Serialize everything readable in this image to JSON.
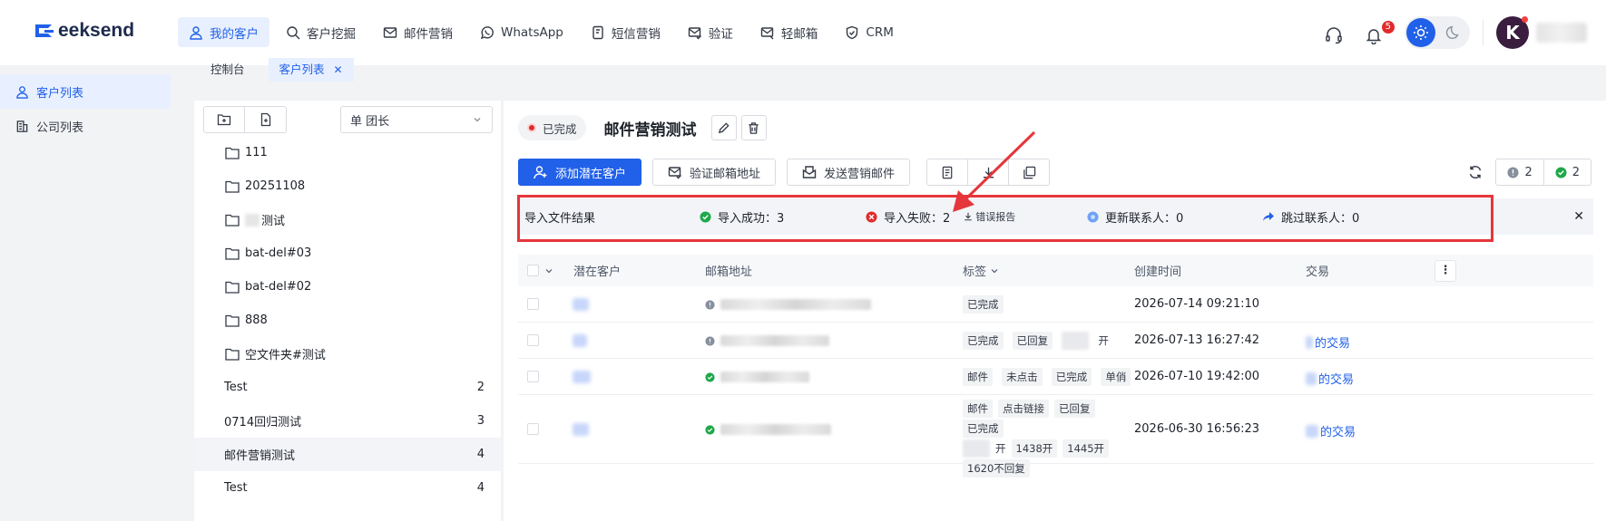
{
  "app": {
    "logo_text": "eeksend",
    "logo_letter": "G",
    "brand_color": "#2160e8",
    "alert_color": "#e5363b"
  },
  "nav": {
    "items": [
      {
        "label": "我的客户",
        "icon": "user-icon",
        "active": true
      },
      {
        "label": "客户挖掘",
        "icon": "search-icon"
      },
      {
        "label": "邮件营销",
        "icon": "mail-icon"
      },
      {
        "label": "WhatsApp",
        "icon": "whatsapp-icon"
      },
      {
        "label": "短信营销",
        "icon": "sms-icon"
      },
      {
        "label": "验证",
        "icon": "mail-check-icon"
      },
      {
        "label": "轻邮箱",
        "icon": "light-mail-icon"
      },
      {
        "label": "CRM",
        "icon": "shield-icon"
      }
    ]
  },
  "header": {
    "notification_count": "5",
    "avatar_letter": "K"
  },
  "page_tabs": {
    "tab1": "控制台",
    "tab2": "客户列表"
  },
  "sidebar": {
    "items": [
      {
        "label": "客户列表",
        "icon": "user-icon",
        "active": true
      },
      {
        "label": "公司列表",
        "icon": "building-icon"
      }
    ]
  },
  "tree": {
    "select_value": "单 团长",
    "rows": [
      {
        "label": "111",
        "chev": "right"
      },
      {
        "label": "20251108",
        "chev": "right"
      },
      {
        "label": "测试",
        "chev": "right"
      },
      {
        "label": "bat-del#03",
        "chev": "down"
      },
      {
        "label": "bat-del#02",
        "chev": "down"
      },
      {
        "label": "888",
        "chev": "down"
      },
      {
        "label": "空文件夹#测试",
        "chev": "right"
      },
      {
        "label": "Test",
        "count": "2"
      },
      {
        "label": "0714回归测试",
        "count": "3"
      },
      {
        "label": "邮件营销测试",
        "count": "4",
        "selected": true
      },
      {
        "label": "Test",
        "count": "4"
      }
    ]
  },
  "main": {
    "status": "已完成",
    "title": "邮件营销测试",
    "actions": {
      "add": "添加潜在客户",
      "verify": "验证邮箱地址",
      "send": "发送营销邮件"
    },
    "count_warn": "2",
    "count_ok": "2",
    "result": {
      "label": "导入文件结果",
      "success": "导入成功：3",
      "fail": "导入失败：2",
      "error_report": "错误报告",
      "updated": "更新联系人：0",
      "skipped": "跳过联系人：0"
    },
    "table": {
      "headers": {
        "customer": "潜在客户",
        "email": "邮箱地址",
        "tags": "标签",
        "created": "创建时间",
        "deal": "交易"
      },
      "rows": [
        {
          "tags": [
            "已完成"
          ],
          "created": "2026-07-14 09:21:10",
          "deal": "",
          "status": "warn"
        },
        {
          "tags": [
            "已完成",
            "已回复",
            "",
            "开"
          ],
          "created": "2026-07-13 16:27:42",
          "deal": "的交易",
          "status": "warn"
        },
        {
          "tags": [
            "邮件",
            "未点击",
            "已完成",
            "单俏"
          ],
          "created": "2026-07-10 19:42:00",
          "deal": "的交易",
          "status": "ok"
        },
        {
          "tags": [
            "邮件",
            "点击链接",
            "已回复",
            "已完成",
            "",
            "开",
            "1438开",
            "1445开",
            "1620不回复"
          ],
          "created": "2026-06-30 16:56:23",
          "deal": "的交易",
          "status": "ok"
        }
      ]
    }
  }
}
